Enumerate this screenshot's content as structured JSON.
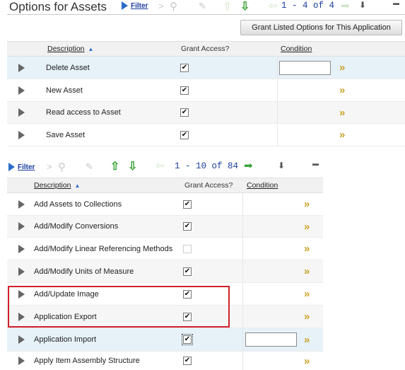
{
  "top": {
    "title": "Options for Assets",
    "filter_label": "Filter",
    "pager_text": "1 - 4 of 4",
    "grant_button": "Grant Listed Options for This Application",
    "columns": {
      "description": "Description",
      "grant": "Grant Access?",
      "condition": "Condition"
    },
    "rows": [
      {
        "description": "Delete Asset",
        "granted": true
      },
      {
        "description": "New Asset",
        "granted": true
      },
      {
        "description": "Read access to Asset",
        "granted": true
      },
      {
        "description": "Save Asset",
        "granted": true
      }
    ]
  },
  "bottom": {
    "filter_label": "Filter",
    "pager_text": "1 - 10 of 84",
    "columns": {
      "description": "Description",
      "grant": "Grant Access?",
      "condition": "Condition"
    },
    "rows": [
      {
        "description": "Add Assets to Collections",
        "granted": true
      },
      {
        "description": "Add/Modify Conversions",
        "granted": true
      },
      {
        "description": "Add/Modify Linear Referencing Methods",
        "granted": false
      },
      {
        "description": "Add/Modify Units of Measure",
        "granted": true
      },
      {
        "description": "Add/Update Image",
        "granted": true
      },
      {
        "description": "Application Export",
        "granted": true
      },
      {
        "description": "Application Import",
        "granted": true
      },
      {
        "description": "Apply Item Assembly Structure",
        "granted": true
      }
    ]
  },
  "glyphs": {
    "check": "✔",
    "double_chevron": "»",
    "chevron": ">",
    "arrow_up": "⇧",
    "arrow_down": "⇩",
    "arrow_left": "⇦",
    "arrow_right": "➡",
    "search": "⚲",
    "pencil": "✎",
    "download": "⬇",
    "minimize": "▬"
  },
  "colors": {
    "selected_row": "#e6f1f8",
    "alt_row": "#f6f6f6",
    "highlight_box": "#d0202a",
    "arrow_green": "#3aa335",
    "chevron_gold": "#c9a227"
  }
}
